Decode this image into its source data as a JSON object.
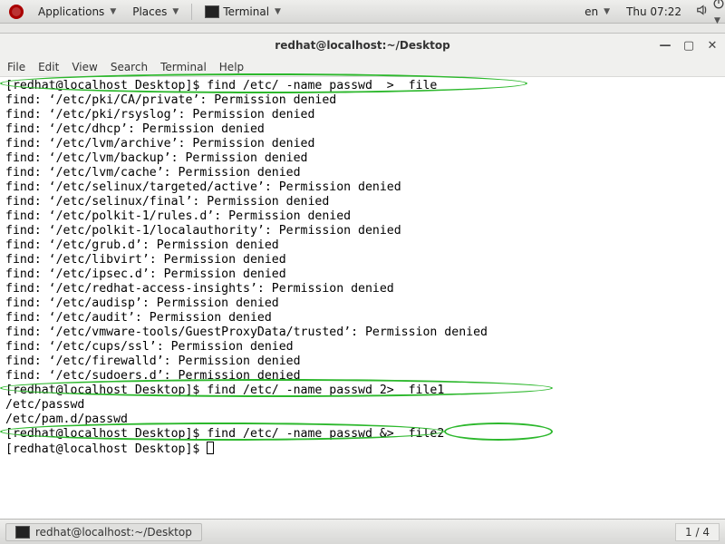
{
  "panel": {
    "applications": "Applications",
    "places": "Places",
    "terminal_launcher": "Terminal",
    "lang": "en",
    "clock": "Thu 07:22"
  },
  "window": {
    "title": "redhat@localhost:~/Desktop",
    "menus": {
      "file": "File",
      "edit": "Edit",
      "view": "View",
      "search": "Search",
      "terminal": "Terminal",
      "help": "Help"
    }
  },
  "terminal": {
    "prompt": "[redhat@localhost Desktop]$ ",
    "cmd1": "find /etc/ -name passwd  >  file",
    "cmd2": "find /etc/ -name passwd 2>  file1",
    "cmd3": "find /etc/ -name passwd &>  file2",
    "err_prefix": "find: ‘",
    "err_suffix": "’: Permission denied",
    "err_paths": [
      "/etc/pki/CA/private",
      "/etc/pki/rsyslog",
      "/etc/dhcp",
      "/etc/lvm/archive",
      "/etc/lvm/backup",
      "/etc/lvm/cache",
      "/etc/selinux/targeted/active",
      "/etc/selinux/final",
      "/etc/polkit-1/rules.d",
      "/etc/polkit-1/localauthority",
      "/etc/grub.d",
      "/etc/libvirt",
      "/etc/ipsec.d",
      "/etc/redhat-access-insights",
      "/etc/audisp",
      "/etc/audit",
      "/etc/vmware-tools/GuestProxyData/trusted",
      "/etc/cups/ssl",
      "/etc/firewalld",
      "/etc/sudoers.d"
    ],
    "out2_line1": "/etc/passwd",
    "out2_line2": "/etc/pam.d/passwd"
  },
  "taskbar": {
    "task_title": "redhat@localhost:~/Desktop",
    "workspace": "1 / 4"
  }
}
